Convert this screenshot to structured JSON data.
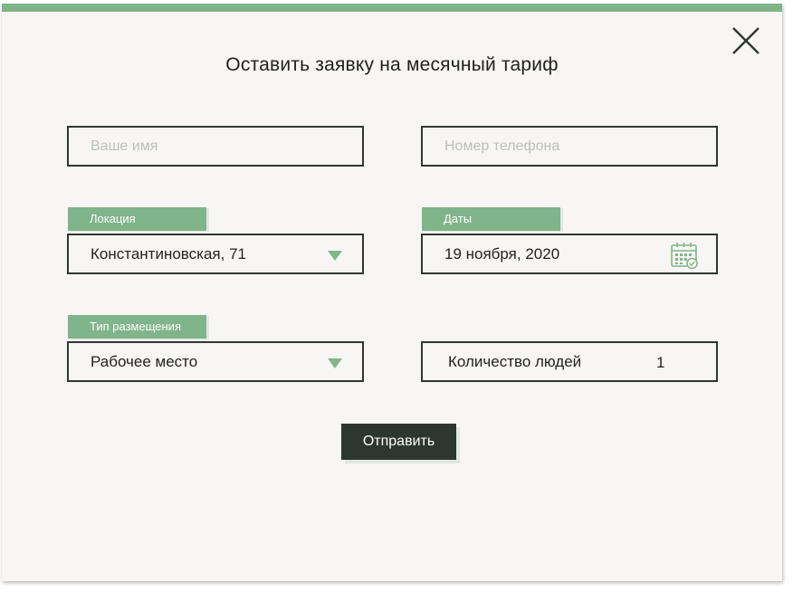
{
  "modal": {
    "title": "Оставить заявку на месячный тариф",
    "close_icon": "close-icon"
  },
  "form": {
    "name": {
      "placeholder": "Ваше имя",
      "value": ""
    },
    "phone": {
      "placeholder": "Номер телефона",
      "value": ""
    },
    "location": {
      "label": "Локация",
      "value": "Константиновская, 71"
    },
    "dates": {
      "label": "Даты",
      "value": "19 ноября, 2020",
      "icon": "calendar-icon"
    },
    "placement": {
      "label": "Тип размещения",
      "value": "Рабочее место"
    },
    "people": {
      "label": "Количество людей",
      "value": "1"
    },
    "submit_label": "Отправить"
  },
  "colors": {
    "accent": "#80b48a",
    "dark": "#2e372f",
    "background": "#f7f6f4",
    "border": "#2f3732",
    "placeholder": "#b9bfbb"
  }
}
